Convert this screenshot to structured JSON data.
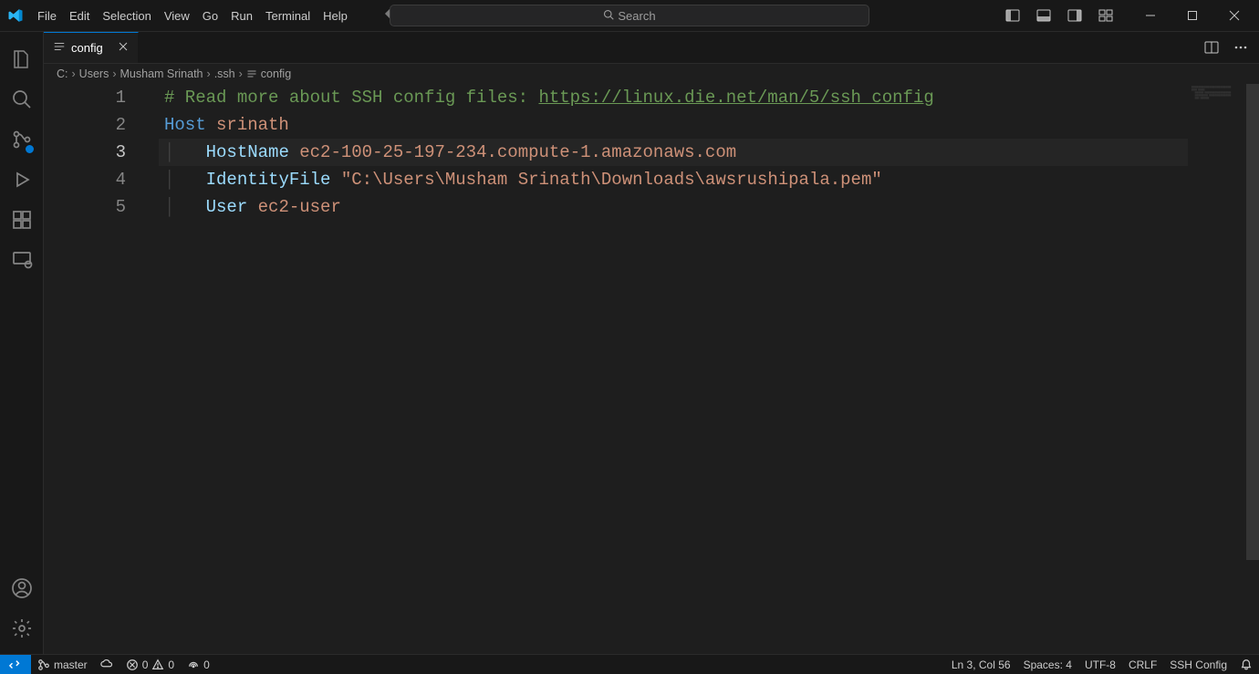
{
  "menu": {
    "file": "File",
    "edit": "Edit",
    "selection": "Selection",
    "view": "View",
    "go": "Go",
    "run": "Run",
    "terminal": "Terminal",
    "help": "Help"
  },
  "search": {
    "placeholder": "Search"
  },
  "tab": {
    "label": "config"
  },
  "breadcrumbs": {
    "c": "C:",
    "users": "Users",
    "person": "Musham Srinath",
    "ssh": ".ssh",
    "file": "config"
  },
  "line_numbers": [
    "1",
    "2",
    "3",
    "4",
    "5"
  ],
  "current_line_index": 2,
  "code": {
    "l1_comment_prefix": "# Read more about SSH config files: ",
    "l1_link": "https://linux.die.net/man/5/ssh_config",
    "l2_key": "Host",
    "l2_value": "srinath",
    "l3_key": "HostName",
    "l3_value": "ec2-100-25-197-234.compute-1.amazonaws.com",
    "l4_key": "IdentityFile",
    "l4_value": "\"C:\\Users\\Musham Srinath\\Downloads\\awsrushipala.pem\"",
    "l5_key": "User",
    "l5_value": "ec2-user"
  },
  "status": {
    "branch": "master",
    "errors": "0",
    "warnings": "0",
    "ports": "0",
    "cursor": "Ln 3, Col 56",
    "spaces": "Spaces: 4",
    "encoding": "UTF-8",
    "eol": "CRLF",
    "language": "SSH Config"
  },
  "colors": {
    "accent": "#0078d4",
    "comment": "#6a9955",
    "keyword_blue": "#569cd6",
    "keyword_light": "#9cdcfe",
    "string": "#ce9178"
  }
}
